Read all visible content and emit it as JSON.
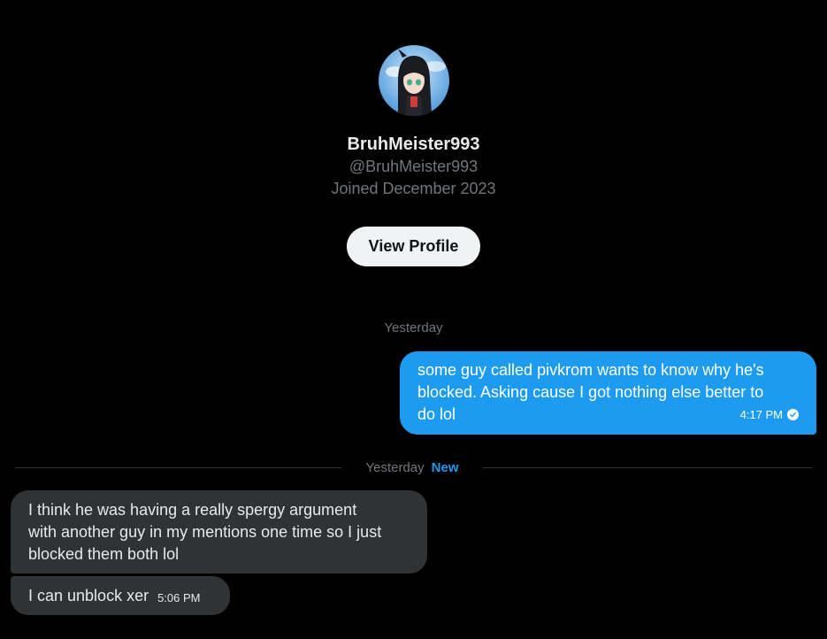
{
  "profile": {
    "display_name": "BruhMeister993",
    "handle": "@BruhMeister993",
    "joined": "Joined December 2023",
    "view_profile_label": "View Profile",
    "avatar_icon": "anime-character-avatar"
  },
  "conversation": {
    "date_separator": "Yesterday",
    "new_divider": {
      "date": "Yesterday",
      "badge": "New"
    },
    "messages": [
      {
        "direction": "outgoing",
        "lines": [
          "some guy called pivkrom wants to know why he's",
          "blocked. Asking cause I got nothing else better to",
          "do lol"
        ],
        "time": "4:17 PM",
        "status_icon": "check-circle-icon"
      },
      {
        "direction": "incoming",
        "lines": [
          "I think he was having a really spergy argument",
          "with another guy in my mentions one time so I just",
          "blocked them both lol"
        ]
      },
      {
        "direction": "incoming",
        "text": "I can unblock xer",
        "time": "5:06 PM"
      }
    ]
  },
  "colors": {
    "background": "#000000",
    "outgoing_bubble": "#1d9bf0",
    "incoming_bubble": "#2f3336",
    "secondary_text": "#71767b",
    "accent": "#1d9bf0"
  }
}
